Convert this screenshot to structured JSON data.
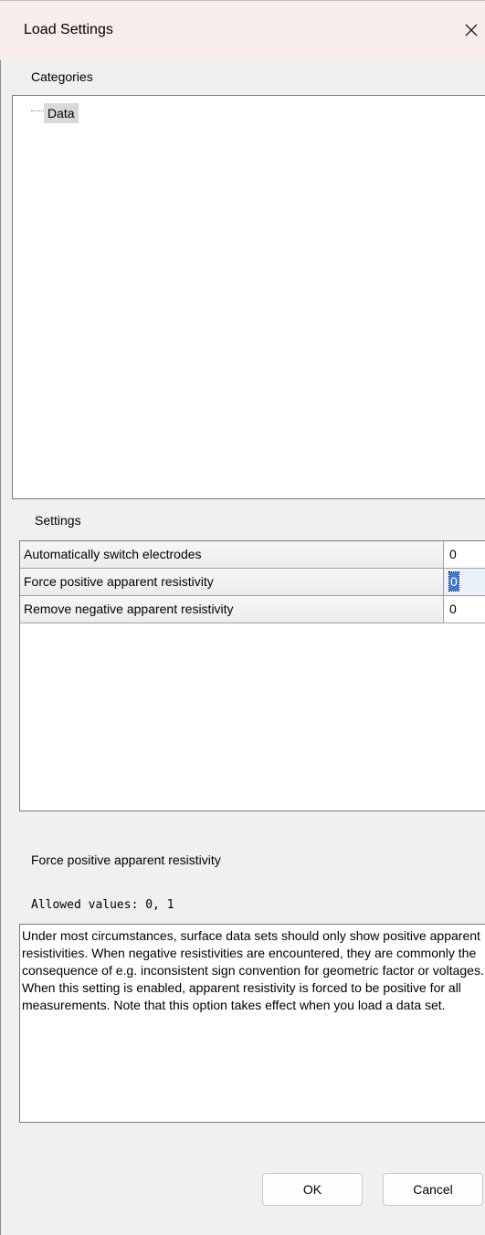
{
  "window": {
    "title": "Load Settings",
    "close_icon": "close-icon"
  },
  "categories": {
    "label": "Categories",
    "items": [
      {
        "label": "Data",
        "selected": true
      }
    ]
  },
  "settings": {
    "label": "Settings",
    "rows": [
      {
        "name": "Automatically switch electrodes",
        "value": "0",
        "selected": false
      },
      {
        "name": "Force positive apparent resistivity",
        "value": "0",
        "selected": true
      },
      {
        "name": "Remove negative apparent resistivity",
        "value": "0",
        "selected": false
      }
    ]
  },
  "description": {
    "title": "Force positive apparent resistivity",
    "allowed_values": "Allowed values: 0, 1",
    "text": "Under most circumstances, surface data sets should only show positive apparent resistivities. When negative resistivities are encountered, they are commonly the consequence of e.g. inconsistent sign convention for geometric factor or voltages. When this setting is enabled, apparent resistivity is forced to be positive for all measurements. Note that this option takes effect when you load a data set."
  },
  "buttons": {
    "ok": "OK",
    "cancel": "Cancel"
  },
  "colors": {
    "titlebar": "#f8ecec",
    "selection": "#3c78d8",
    "tree_highlight": "#d9d9d9"
  }
}
